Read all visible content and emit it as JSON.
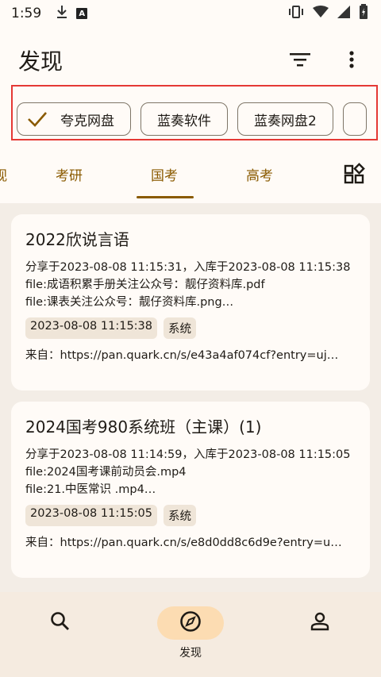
{
  "status": {
    "time": "1:59"
  },
  "header": {
    "title": "发现"
  },
  "chips": [
    {
      "label": "夸克网盘",
      "selected": true
    },
    {
      "label": "蓝奏软件",
      "selected": false
    },
    {
      "label": "蓝奏网盘2",
      "selected": false
    }
  ],
  "tabs": {
    "partial_left": "视",
    "items": [
      "考研",
      "国考",
      "高考"
    ],
    "active_index": 1
  },
  "cards": [
    {
      "title": "2022欣说言语",
      "meta": "分享于2023-08-08 11:15:31，入库于2023-08-08 11:15:38",
      "files": [
        "file:成语积累手册关注公众号：靓仔资料库.pdf",
        "file:课表关注公众号：靓仔资料库.png…"
      ],
      "tags": [
        "2023-08-08 11:15:38",
        "系统"
      ],
      "from": "来自：https://pan.quark.cn/s/e43a4af074cf?entry=uj…"
    },
    {
      "title": "2024国考980系统班（主课）(1)",
      "meta": "分享于2023-08-08 11:14:59，入库于2023-08-08 11:15:05",
      "files": [
        "file:2024国考课前动员会.mp4",
        "file:21.中医常识  .mp4…"
      ],
      "tags": [
        "2023-08-08 11:15:05",
        "系统"
      ],
      "from": "来自：https://pan.quark.cn/s/e8d0dd8c6d9e?entry=u…"
    }
  ],
  "bottom_nav": {
    "discover_label": "发现"
  },
  "colors": {
    "accent": "#8a5a00",
    "highlight_border": "#e53935",
    "nav_active": "#fcdcb2"
  }
}
